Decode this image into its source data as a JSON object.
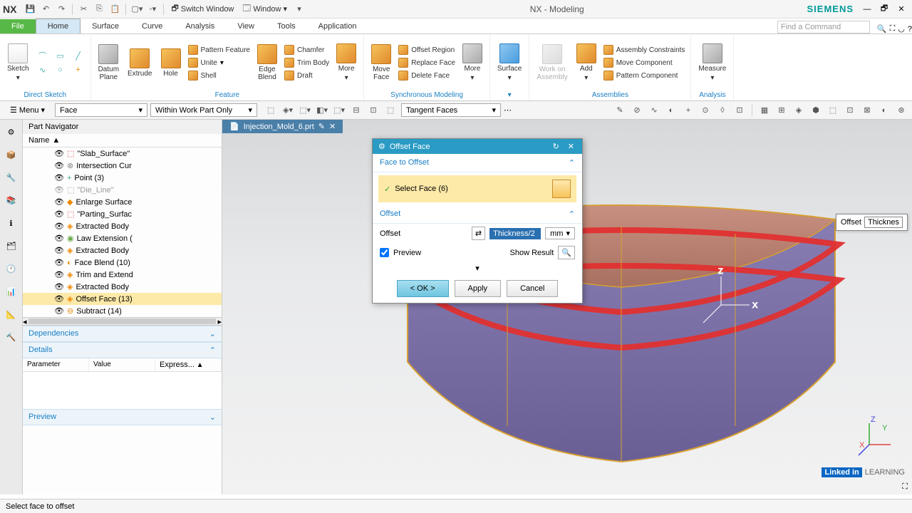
{
  "app": {
    "title": "NX - Modeling",
    "logo": "NX",
    "brand": "SIEMENS"
  },
  "titlebar": {
    "switch_window": "Switch Window",
    "window": "Window",
    "find_placeholder": "Find a Command"
  },
  "tabs": {
    "file": "File",
    "home": "Home",
    "surface": "Surface",
    "curve": "Curve",
    "analysis": "Analysis",
    "view": "View",
    "tools": "Tools",
    "application": "Application"
  },
  "ribbon": {
    "sketch": "Sketch",
    "direct_sketch": "Direct Sketch",
    "datum_plane": "Datum\nPlane",
    "extrude": "Extrude",
    "hole": "Hole",
    "pattern_feature": "Pattern Feature",
    "unite": "Unite",
    "shell": "Shell",
    "feature": "Feature",
    "edge_blend": "Edge\nBlend",
    "chamfer": "Chamfer",
    "trim_body": "Trim Body",
    "draft": "Draft",
    "more": "More",
    "move_face": "Move\nFace",
    "offset_region": "Offset Region",
    "replace_face": "Replace Face",
    "delete_face": "Delete Face",
    "sync_modeling": "Synchronous Modeling",
    "surface": "Surface",
    "work_on_assembly": "Work on\nAssembly",
    "add": "Add",
    "assembly_constraints": "Assembly Constraints",
    "move_component": "Move Component",
    "pattern_component": "Pattern Component",
    "assemblies": "Assemblies",
    "measure": "Measure",
    "analysis": "Analysis"
  },
  "selbar": {
    "menu": "Menu",
    "filter1": "Face",
    "filter2": "Within Work Part Only",
    "filter3": "Tangent Faces"
  },
  "nav": {
    "title": "Part Navigator",
    "col_name": "Name",
    "items": [
      "\"Slab_Surface\"",
      "Intersection Cur",
      "Point (3)",
      "\"Die_Line\"",
      "Enlarge Surface",
      "\"Parting_Surfac",
      "Extracted Body",
      "Law Extension (",
      "Extracted Body",
      "Face Blend (10)",
      "Trim and Extend",
      "Extracted Body",
      "Offset Face (13)",
      "Subtract (14)"
    ],
    "dependencies": "Dependencies",
    "details": "Details",
    "col_param": "Parameter",
    "col_value": "Value",
    "col_expr": "Express...",
    "preview": "Preview"
  },
  "filetab": {
    "name": "Injection_Mold_6.prt"
  },
  "dialog": {
    "title": "Offset Face",
    "sec_face": "Face to Offset",
    "select_face": "Select Face (6)",
    "sec_offset": "Offset",
    "label_offset": "Offset",
    "offset_value": "Thickness/2",
    "unit": "mm",
    "preview": "Preview",
    "show_result": "Show Result",
    "ok": "< OK >",
    "apply": "Apply",
    "cancel": "Cancel"
  },
  "float": {
    "label": "Offset",
    "value": "Thicknes"
  },
  "status": {
    "text": "Select face to offset"
  },
  "footer": {
    "linkedin": "Linked in",
    "learning": "LEARNING"
  },
  "axes": {
    "x": "X",
    "y": "Y",
    "z": "Z"
  }
}
